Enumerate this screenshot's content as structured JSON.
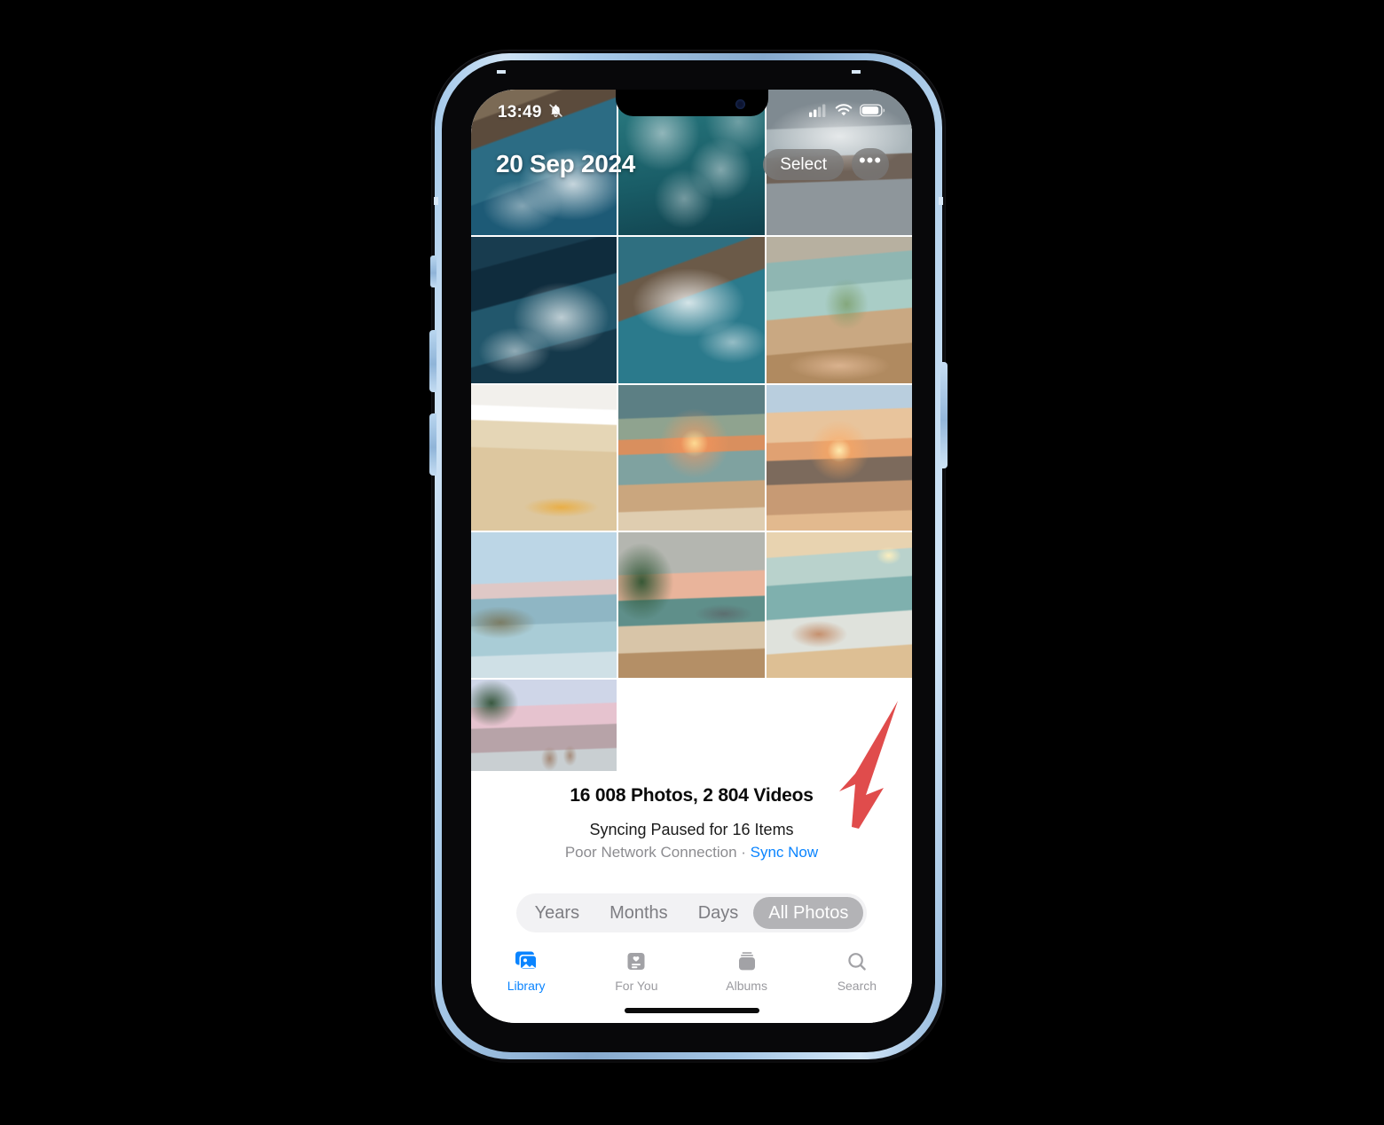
{
  "device": {
    "name": "iphone-14",
    "frame_color": "#a9cbea"
  },
  "status_bar": {
    "time": "13:49",
    "mute_icon": "bell-slash-icon",
    "signal_icon": "cellular-signal-icon",
    "signal_bars_filled": 2,
    "signal_bars_total": 4,
    "wifi_icon": "wifi-icon",
    "battery_icon": "battery-icon",
    "battery_level": 78
  },
  "header": {
    "date": "20 Sep 2024",
    "select_label": "Select",
    "more_label": "•••",
    "more_icon": "ellipsis-icon"
  },
  "grid": {
    "photos": [
      {
        "alt": "ocean-waves-rocky-shore",
        "kind": "waves-rock"
      },
      {
        "alt": "clear-turquoise-water-surface",
        "kind": "turquoise-water"
      },
      {
        "alt": "grey-surf-breaking-on-beach",
        "kind": "grey-surf"
      },
      {
        "alt": "whitewater-over-dark-rocks",
        "kind": "waves-rock-dark"
      },
      {
        "alt": "foamy-sea-over-reef",
        "kind": "foam-reef"
      },
      {
        "alt": "rose-wine-glasses-by-the-sea",
        "kind": "wine-sea"
      },
      {
        "alt": "starfish-on-sandy-beach-with-foam",
        "kind": "starfish-sand"
      },
      {
        "alt": "sunset-over-shoreline",
        "kind": "sunset-shore"
      },
      {
        "alt": "golden-sunset-over-calm-sea",
        "kind": "sunset-sea"
      },
      {
        "alt": "rocky-coastline-at-dawn",
        "kind": "coast-dawn"
      },
      {
        "alt": "palm-trees-on-tropical-beach-at-sunset",
        "kind": "palm-beach"
      },
      {
        "alt": "hand-touching-sunlit-wave",
        "kind": "hand-wave"
      },
      {
        "alt": "capri-coastline-with-boats-at-dusk",
        "kind": "capri-dusk"
      }
    ]
  },
  "library_status": {
    "counts": "16 008 Photos, 2 804 Videos",
    "sync_state": "Syncing Paused for 16 Items",
    "sync_reason": "Poor Network Connection",
    "separator": " · ",
    "sync_action": "Sync Now",
    "sync_action_color": "#0a84ff"
  },
  "segmented_control": {
    "options": [
      "Years",
      "Months",
      "Days",
      "All Photos"
    ],
    "selected": "All Photos"
  },
  "tab_bar": {
    "tabs": [
      {
        "label": "Library",
        "icon": "photo-stack-icon",
        "active": true
      },
      {
        "label": "For You",
        "icon": "for-you-card-icon",
        "active": false
      },
      {
        "label": "Albums",
        "icon": "albums-stack-icon",
        "active": false
      },
      {
        "label": "Search",
        "icon": "search-icon",
        "active": false
      }
    ],
    "active_color": "#0a84ff",
    "inactive_color": "#9a9a9f"
  },
  "annotation": {
    "type": "arrow",
    "color": "#e04c4c",
    "points_to": "Sync Now"
  }
}
